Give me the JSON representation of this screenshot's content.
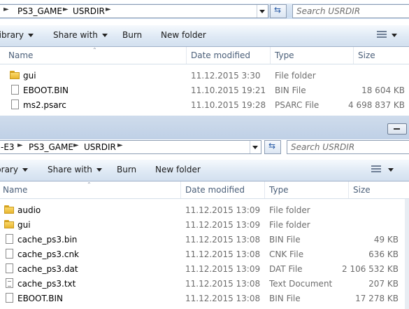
{
  "colors": {
    "toolbar_top": "#f5f9fd",
    "toolbar_bottom": "#d3e0ef",
    "header_text": "#4c607a",
    "address_bg": "#c9daee",
    "folder": "#e8b630"
  },
  "top": {
    "breadcrumb": [
      "PS3_GAME",
      "USRDIR"
    ],
    "search_placeholder": "Search USRDIR",
    "toolbar": {
      "library": "Library",
      "share": "Share with",
      "burn": "Burn",
      "new_folder": "New folder"
    },
    "columns": {
      "name": "Name",
      "date": "Date modified",
      "type": "Type",
      "size": "Size"
    },
    "rows": [
      {
        "name": "gui",
        "date": "11.12.2015 3:30",
        "type": "File folder",
        "size": "",
        "icon": "folder-icon"
      },
      {
        "name": "EBOOT.BIN",
        "date": "11.10.2015 19:21",
        "type": "BIN File",
        "size": "18 604 KB",
        "icon": "file-icon"
      },
      {
        "name": "ms2.psarc",
        "date": "11.10.2015 19:28",
        "type": "PSARC File",
        "size": "4 698 837 KB",
        "icon": "file-icon"
      }
    ]
  },
  "bottom": {
    "breadcrumb": [
      "-E3",
      "PS3_GAME",
      "USRDIR"
    ],
    "search_placeholder": "Search USRDIR",
    "toolbar": {
      "library": "Library",
      "share": "Share with",
      "burn": "Burn",
      "new_folder": "New folder"
    },
    "columns": {
      "name": "Name",
      "date": "Date modified",
      "type": "Type",
      "size": "Size"
    },
    "rows": [
      {
        "name": "audio",
        "date": "11.12.2015 13:09",
        "type": "File folder",
        "size": "",
        "icon": "folder-icon"
      },
      {
        "name": "gui",
        "date": "11.12.2015 13:09",
        "type": "File folder",
        "size": "",
        "icon": "folder-icon"
      },
      {
        "name": "cache_ps3.bin",
        "date": "11.12.2015 13:08",
        "type": "BIN File",
        "size": "49 KB",
        "icon": "file-icon"
      },
      {
        "name": "cache_ps3.cnk",
        "date": "11.12.2015 13:08",
        "type": "CNK File",
        "size": "636 KB",
        "icon": "file-icon"
      },
      {
        "name": "cache_ps3.dat",
        "date": "11.12.2015 13:09",
        "type": "DAT File",
        "size": "2 106 532 KB",
        "icon": "file-icon"
      },
      {
        "name": "cache_ps3.txt",
        "date": "11.12.2015 13:08",
        "type": "Text Document",
        "size": "207 KB",
        "icon": "text-file-icon"
      },
      {
        "name": "EBOOT.BIN",
        "date": "11.12.2015 13:08",
        "type": "BIN File",
        "size": "17 278 KB",
        "icon": "file-icon"
      }
    ]
  }
}
